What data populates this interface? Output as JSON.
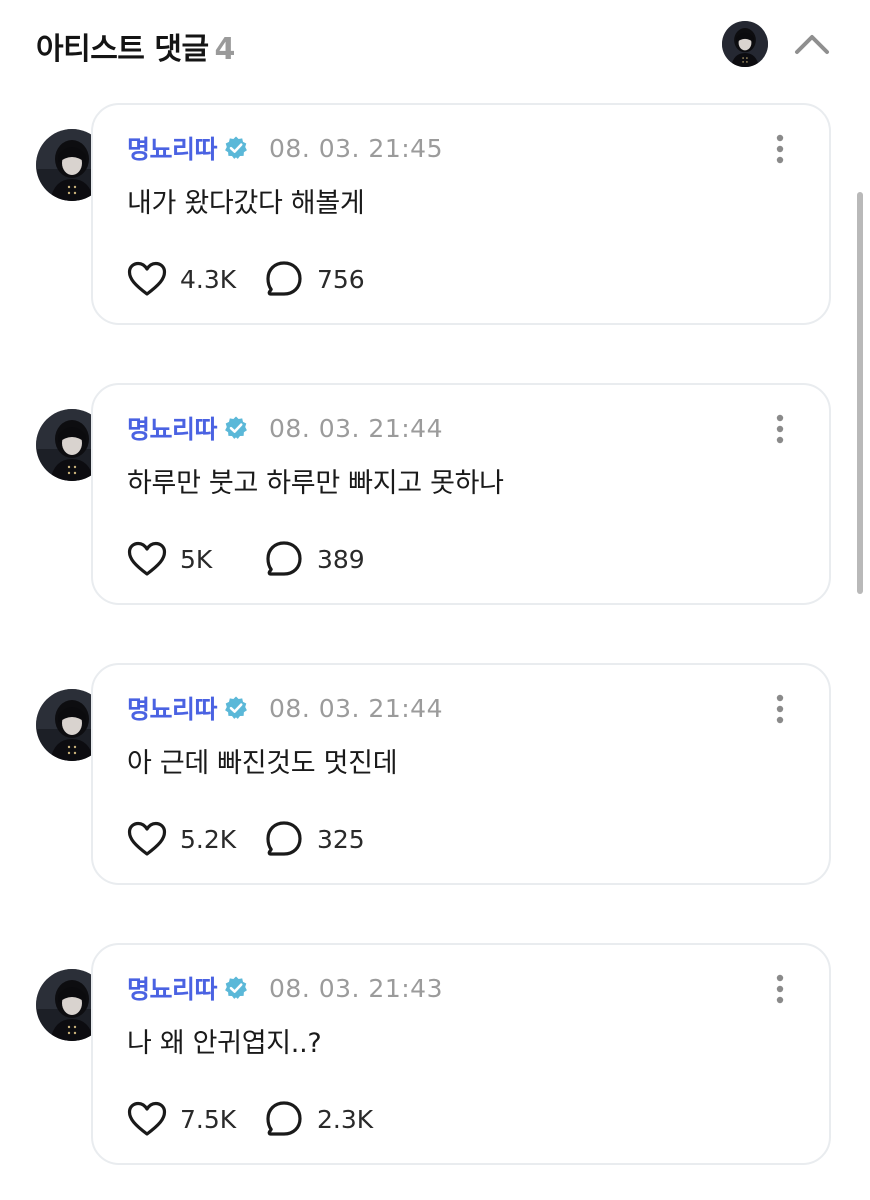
{
  "header": {
    "title": "아티스트 댓글",
    "count": "4",
    "avatar_icon": "artist-avatar",
    "collapse_icon": "chevron-up-icon"
  },
  "colors": {
    "name": "#4a62e2",
    "verified": "#5bb8d8",
    "timestamp": "#9b9b9b",
    "card_border": "#e9ecef"
  },
  "comments": [
    {
      "author": "명뇨리따",
      "timestamp": "08. 03. 21:45",
      "text": "내가 왔다갔다 해볼게",
      "likes": "4.3K",
      "replies": "756"
    },
    {
      "author": "명뇨리따",
      "timestamp": "08. 03. 21:44",
      "text": "하루만 붓고 하루만 빠지고 못하나",
      "likes": "5K",
      "replies": "389"
    },
    {
      "author": "명뇨리따",
      "timestamp": "08. 03. 21:44",
      "text": "아 근데 빠진것도 멋진데",
      "likes": "5.2K",
      "replies": "325"
    },
    {
      "author": "명뇨리따",
      "timestamp": "08. 03. 21:43",
      "text": "나 왜 안귀엽지..?",
      "likes": "7.5K",
      "replies": "2.3K"
    }
  ]
}
